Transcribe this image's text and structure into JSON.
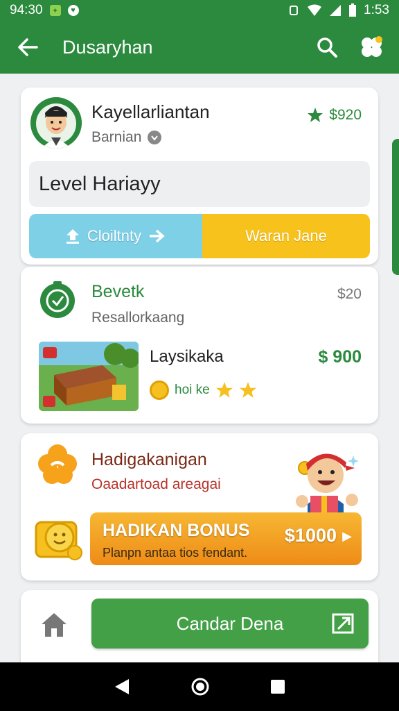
{
  "status_bar": {
    "time_left": "94:30",
    "time_right": "1:53"
  },
  "app_bar": {
    "title": "Dusaryhan"
  },
  "profile_card": {
    "name": "Kayellarliantan",
    "subtitle": "Barnian",
    "price": "$920",
    "level_text": "Level Hariayy",
    "button_left": "Cloiltnty",
    "button_right": "Waran Jane"
  },
  "item_card": {
    "title": "Bevetk",
    "subtitle": "Resallorkaang",
    "price": "$20",
    "item_name": "Laysikaka",
    "item_price": "$ 900",
    "item_tag": "hoi ke"
  },
  "bonus_card": {
    "title": "Hadigakanigan",
    "subtitle": "Oaadartoad areagai",
    "banner_title": "HADIKAN BONUS",
    "banner_subtitle": "Planpn antaa tios fendant.",
    "banner_amount": "$1000"
  },
  "footer_card": {
    "cta_label": "Candar Dena"
  },
  "colors": {
    "primary": "#2b8a3e",
    "accent_yellow": "#f7c21c",
    "accent_blue": "#7dd0e6",
    "accent_orange": "#ee8b17"
  },
  "icons": [
    "back-arrow-icon",
    "search-icon",
    "clover-icon",
    "star-icon",
    "coin-icon",
    "home-icon",
    "external-link-icon",
    "upload-icon",
    "timer-icon",
    "flower-icon"
  ]
}
